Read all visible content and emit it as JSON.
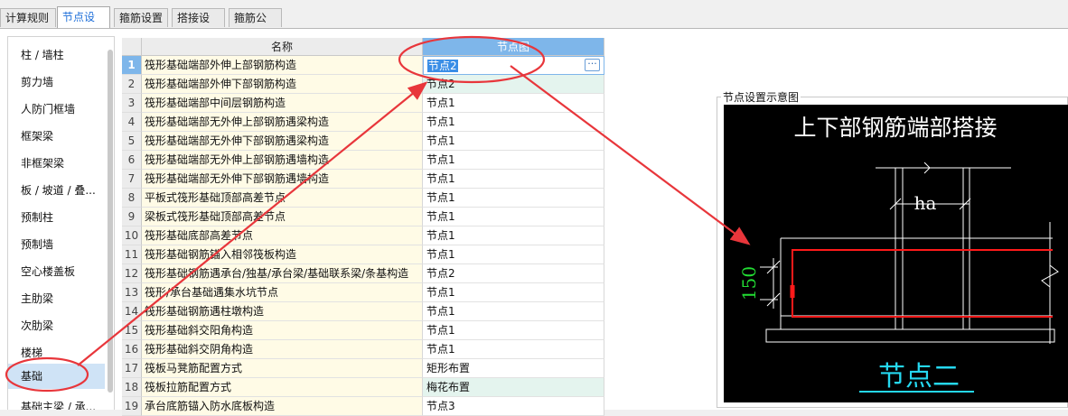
{
  "tabs": [
    "计算规则",
    "节点设置",
    "箍筋设置",
    "搭接设置",
    "箍筋公式"
  ],
  "active_tab": 1,
  "sidebar": {
    "items": [
      "柱 / 墙柱",
      "剪力墙",
      "人防门框墙",
      "框架梁",
      "非框架梁",
      "板 / 坡道 / 叠...",
      "预制柱",
      "预制墙",
      "空心楼盖板",
      "主肋梁",
      "次肋梁",
      "楼梯",
      "基础",
      "基础主梁 / 承..."
    ],
    "selected": "基础"
  },
  "table": {
    "headers": {
      "name": "名称",
      "node": "节点图"
    },
    "editing_row": "1",
    "ellipsis": "···",
    "rows": [
      {
        "num": "1",
        "name": "筏形基础端部外伸上部钢筋构造",
        "node": "节点2"
      },
      {
        "num": "2",
        "name": "筏形基础端部外伸下部钢筋构造",
        "node": "节点2"
      },
      {
        "num": "3",
        "name": "筏形基础端部中间层钢筋构造",
        "node": "节点1"
      },
      {
        "num": "4",
        "name": "筏形基础端部无外伸上部钢筋遇梁构造",
        "node": "节点1"
      },
      {
        "num": "5",
        "name": "筏形基础端部无外伸下部钢筋遇梁构造",
        "node": "节点1"
      },
      {
        "num": "6",
        "name": "筏形基础端部无外伸上部钢筋遇墙构造",
        "node": "节点1"
      },
      {
        "num": "7",
        "name": "筏形基础端部无外伸下部钢筋遇墙构造",
        "node": "节点1"
      },
      {
        "num": "8",
        "name": "平板式筏形基础顶部高差节点",
        "node": "节点1"
      },
      {
        "num": "9",
        "name": "梁板式筏形基础顶部高差节点",
        "node": "节点1"
      },
      {
        "num": "10",
        "name": "筏形基础底部高差节点",
        "node": "节点1"
      },
      {
        "num": "11",
        "name": "筏形基础钢筋锚入相邻筏板构造",
        "node": "节点1"
      },
      {
        "num": "12",
        "name": "筏形基础钢筋遇承台/独基/承台梁/基础联系梁/条基构造",
        "node": "节点2"
      },
      {
        "num": "13",
        "name": "筏形/承台基础遇集水坑节点",
        "node": "节点1"
      },
      {
        "num": "14",
        "name": "筏形基础钢筋遇柱墩构造",
        "node": "节点1"
      },
      {
        "num": "15",
        "name": "筏形基础斜交阳角构造",
        "node": "节点1"
      },
      {
        "num": "16",
        "name": "筏形基础斜交阴角构造",
        "node": "节点1"
      },
      {
        "num": "17",
        "name": "筏板马凳筋配置方式",
        "node": "矩形布置"
      },
      {
        "num": "18",
        "name": "筏板拉筋配置方式",
        "node": "梅花布置"
      },
      {
        "num": "19",
        "name": "承台底筋锚入防水底板构造",
        "node": "节点3"
      }
    ],
    "green_rows": [
      "2",
      "18"
    ]
  },
  "preview": {
    "panel_title": "节点设置示意图",
    "title": "上下部钢筋端部搭接",
    "dim_ha": "ha",
    "dim_150": "150",
    "caption": "节点二",
    "colors": {
      "title": "#ffffff",
      "lines": "#ffffff",
      "rebar": "#ff1a1a",
      "dim_150": "#22dd33",
      "caption": "#25d8f0"
    }
  },
  "annotation_color": "#e8363b"
}
